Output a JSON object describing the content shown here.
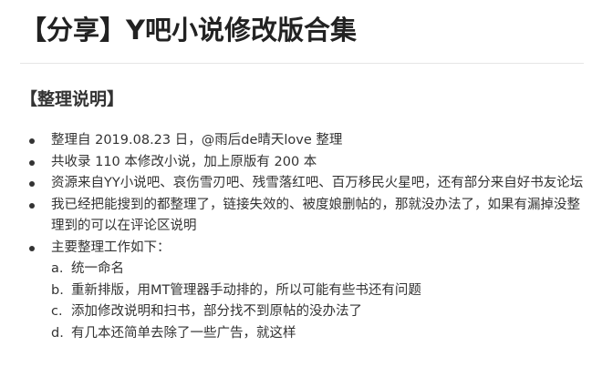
{
  "title": "【分享】Y吧小说修改版合集",
  "section_heading": "【整理说明】",
  "bullets": [
    "整理自 2019.08.23 日，@雨后de晴天love 整理",
    "共收录 110 本修改小说，加上原版有 200 本",
    "资源来自YY小说吧、哀伤雪刃吧、残雪落红吧、百万移民火星吧，还有部分来自好书友论坛",
    "我已经把能搜到的都整理了，链接失效的、被度娘删帖的，那就没办法了，如果有漏掉没整理到的可以在评论区说明",
    "主要整理工作如下："
  ],
  "subitems": [
    {
      "marker": "a.",
      "text": "统一命名"
    },
    {
      "marker": "b.",
      "text": "重新排版，用MT管理器手动排的，所以可能有些书还有问题"
    },
    {
      "marker": "c.",
      "text": "添加修改说明和扫书，部分找不到原帖的没办法了"
    },
    {
      "marker": "d.",
      "text": "有几本还简单去除了一些广告，就这样"
    }
  ]
}
